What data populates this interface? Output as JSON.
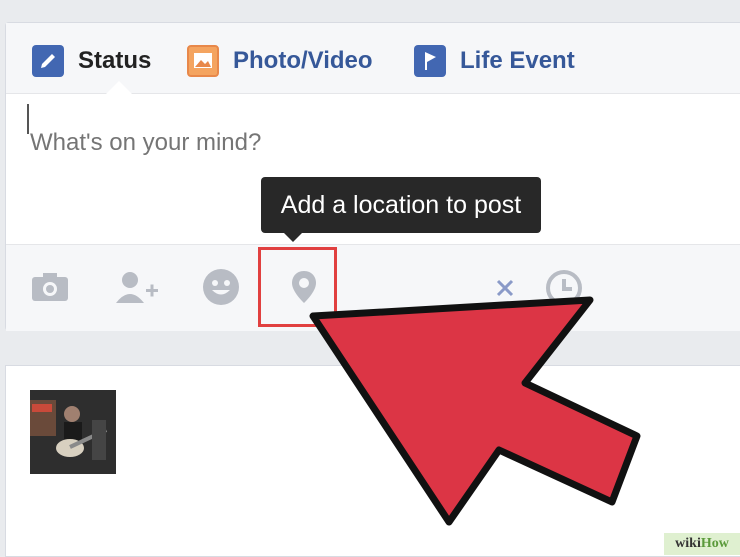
{
  "composer": {
    "tabs": [
      {
        "label": "Status",
        "icon": "pencil-icon"
      },
      {
        "label": "Photo/Video",
        "icon": "photo-icon"
      },
      {
        "label": "Life Event",
        "icon": "flag-icon"
      }
    ],
    "placeholder": "What's on your mind?",
    "actions": [
      {
        "icon": "camera-icon"
      },
      {
        "icon": "tag-friends-icon"
      },
      {
        "icon": "feeling-smiley-icon"
      },
      {
        "icon": "location-pin-icon"
      },
      {
        "icon": "remove-x-icon"
      },
      {
        "icon": "schedule-clock-icon"
      }
    ],
    "tooltip": "Add a location to post"
  },
  "watermark": {
    "prefix": "wiki",
    "suffix": "How"
  },
  "colors": {
    "accent": "#4267b2",
    "link": "#365899",
    "annotation_red": "#dc3545",
    "tooltip_bg": "#282828"
  }
}
